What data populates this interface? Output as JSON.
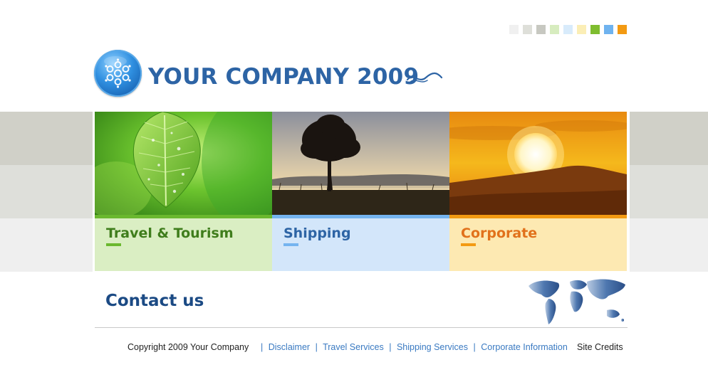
{
  "brand": {
    "title": "YOUR COMPANY 2009",
    "logo_icon": "flower-globe-icon",
    "swirl_icon": "decorative-swirl-icon",
    "title_color": "#2d64a5"
  },
  "swatches": [
    "#f0f0f0",
    "#dedfd9",
    "#c7c8c1",
    "#d7ecbf",
    "#d8ebfb",
    "#fbeeb6",
    "#7fbd2f",
    "#6fb3ef",
    "#f39a12"
  ],
  "panels": [
    {
      "label": "Travel & Tourism",
      "image": "green-leaf-photo",
      "accent": "#6ab82e",
      "label_color": "#3f7d1c",
      "caption_bg": "#daeec3"
    },
    {
      "label": "Shipping",
      "image": "tree-silhouette-photo",
      "accent": "#75b4ef",
      "label_color": "#2d64a5",
      "caption_bg": "#d3e6fa"
    },
    {
      "label": "Corporate",
      "image": "sunset-photo",
      "accent": "#f39a12",
      "label_color": "#e1711b",
      "caption_bg": "#fde9b2"
    }
  ],
  "contact": {
    "label": "Contact us",
    "map_icon": "world-map-icon"
  },
  "footer": {
    "copyright": "Copyright 2009 Your Company",
    "links": [
      "Disclaimer",
      "Travel Services",
      "Shipping Services",
      "Corporate Information"
    ],
    "credits": "Site Credits"
  }
}
